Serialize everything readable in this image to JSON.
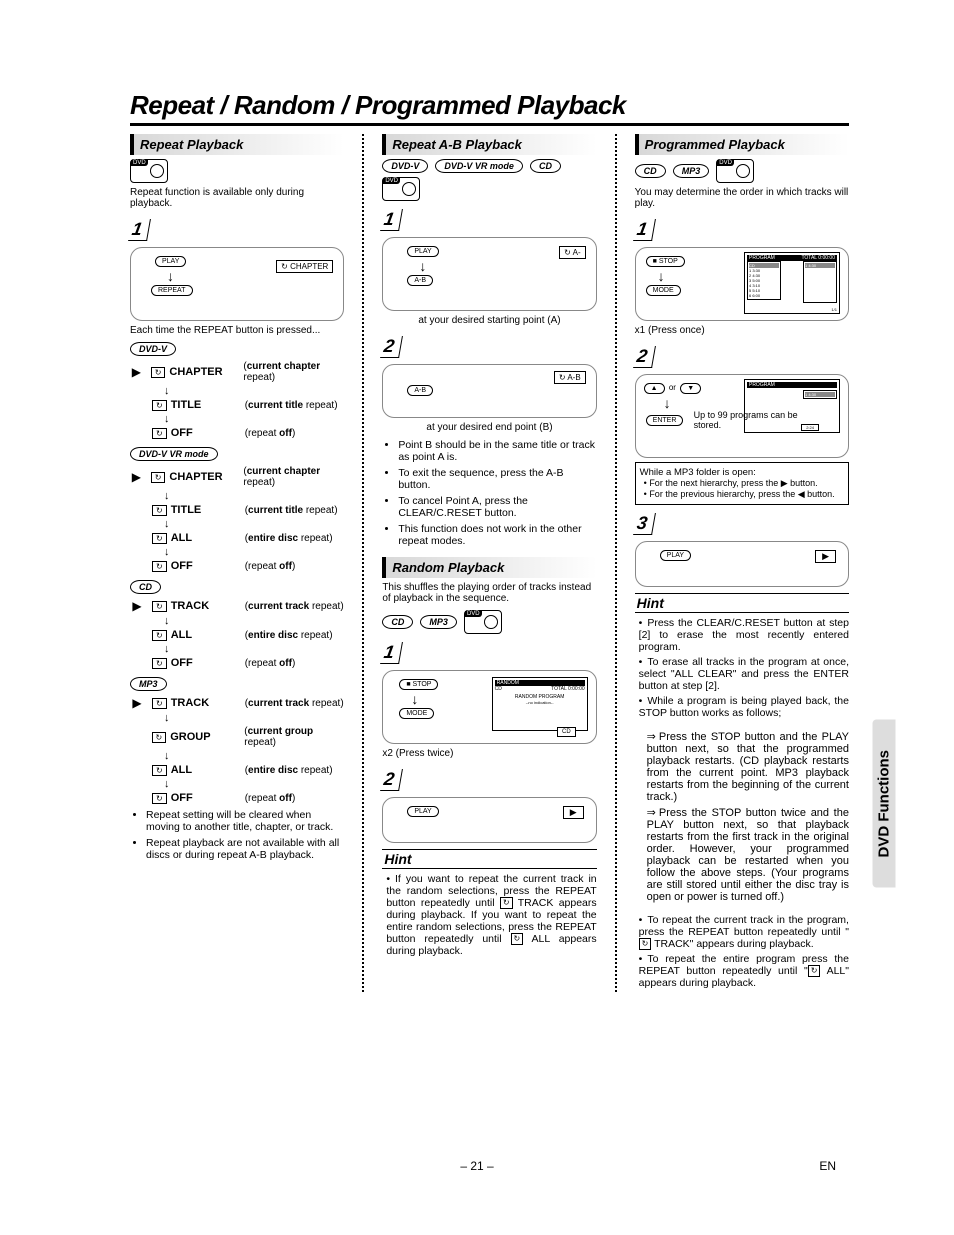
{
  "page": {
    "title": "Repeat / Random / Programmed Playback",
    "number": "– 21 –",
    "lang": "EN",
    "side_tab": "DVD Functions"
  },
  "col1": {
    "head": "Repeat Playback",
    "intro": "Repeat function is available only during playback.",
    "diagram1": {
      "play": "PLAY",
      "osd": "CHAPTER",
      "repeat": "REPEAT"
    },
    "diagram1_caption": "Each time the REPEAT button is pressed...",
    "badges": {
      "dvdv": "DVD-V",
      "dvdv_vr": "DVD-V VR mode",
      "cd": "CD",
      "mp3": "MP3"
    },
    "flow_dvdv": [
      {
        "label": "CHAPTER",
        "desc_b": "current chapter",
        "desc_end": " repeat)"
      },
      {
        "label": "TITLE",
        "desc_b": "current title",
        "desc_end": " repeat)"
      },
      {
        "label": "OFF",
        "desc_plain": "(repeat ",
        "desc_b2": "off",
        "desc_end2": ")"
      }
    ],
    "flow_dvdv_vr": [
      {
        "label": "CHAPTER",
        "desc_b": "current chapter",
        "desc_end": " repeat)"
      },
      {
        "label": "TITLE",
        "desc_b": "current title",
        "desc_end": " repeat)"
      },
      {
        "label": "ALL",
        "desc_b": "entire disc",
        "desc_end": " repeat)"
      },
      {
        "label": "OFF",
        "desc_plain": "(repeat ",
        "desc_b2": "off",
        "desc_end2": ")"
      }
    ],
    "flow_cd": [
      {
        "label": "TRACK",
        "desc_b": "current track",
        "desc_end": " repeat)"
      },
      {
        "label": "ALL",
        "desc_b": "entire disc",
        "desc_end": " repeat)"
      },
      {
        "label": "OFF",
        "desc_plain": "(repeat ",
        "desc_b2": "off",
        "desc_end2": ")"
      }
    ],
    "flow_mp3": [
      {
        "label": "TRACK",
        "desc_b": "current track",
        "desc_end": " repeat)"
      },
      {
        "label": "GROUP",
        "desc_b": "current group",
        "desc_end": " repeat)"
      },
      {
        "label": "ALL",
        "desc_b": "entire disc",
        "desc_end": " repeat)"
      },
      {
        "label": "OFF",
        "desc_plain": "(repeat ",
        "desc_b2": "off",
        "desc_end2": ")"
      }
    ],
    "notes": [
      "Repeat setting will be cleared when moving to another title, chapter, or track.",
      "Repeat playback are not available with all discs or during repeat A-B playback."
    ]
  },
  "col2": {
    "head_a": "Repeat A-B Playback",
    "badges": {
      "dvdv": "DVD-V",
      "dvdv_vr": "DVD-V VR mode",
      "cd": "CD"
    },
    "step1": {
      "num": "1",
      "play": "PLAY",
      "osd": "A-",
      "btn": "A-B",
      "caption": "at your desired starting point (A)"
    },
    "step2": {
      "num": "2",
      "osd": "A-B",
      "btn": "A-B",
      "caption": "at your desired end point (B)"
    },
    "ab_bullets": [
      "Point B should be in the same title or track as point A is.",
      "To exit the sequence, press the A-B button.",
      "To cancel Point A, press the CLEAR/C.RESET button.",
      "This function does not work in the other repeat modes."
    ],
    "head_b": "Random Playback",
    "random_intro": "This shuffles the playing order of tracks instead of playback in the sequence.",
    "rand_step1": {
      "num": "1",
      "stop": "STOP",
      "mode": "MODE",
      "caption": "x2 (Press twice)",
      "screen_title": "RANDOM",
      "screen_sub": "RANDOM PROGRAM",
      "screen_text": "--no indication--",
      "screen_top": "CD",
      "screen_right": "TOTAL  0:00:00"
    },
    "rand_step2": {
      "num": "2",
      "play": "PLAY"
    },
    "hint": "Hint",
    "hint_text": "If you want to repeat the current track in the random selections, press the REPEAT button repeatedly until  TRACK appears during playback. If you want to repeat the entire random selections, press the REPEAT button repeatedly until  ALL appears during playback."
  },
  "col3": {
    "head": "Programmed Playback",
    "badges": {
      "cd": "CD",
      "mp3": "MP3"
    },
    "intro": "You may determine the order in which tracks will play.",
    "step1": {
      "num": "1",
      "stop": "STOP",
      "mode": "MODE",
      "caption": "x1 (Press once)",
      "screen_title": "PROGRAM",
      "screen_sub": "CD",
      "screen_right": "TOTAL 0:00:00",
      "list_items": [
        "1  3:30",
        "2  4:30",
        "3  5:00",
        "4  3:10",
        "5  5:10",
        "6  6:00",
        "7",
        "8"
      ],
      "prog_item": "1  4:30",
      "footer": "1/1"
    },
    "step2": {
      "num": "2",
      "or": "or",
      "up": "▲",
      "down": "▼",
      "enter": "ENTER",
      "store_text": "Up to 99 programs can be stored.",
      "screen_title": "PROGRAM",
      "prog_item": "1  4:30",
      "footer": "2:24"
    },
    "note_box": {
      "line1": "While a MP3 folder is open:",
      "line2": "For the next hierarchy, press the ▶ button.",
      "line3": "For the previous hierarchy, press the ◀ button."
    },
    "step3": {
      "num": "3",
      "play": "PLAY"
    },
    "hint": "Hint",
    "hints": [
      "Press the CLEAR/C.RESET button at step [2] to erase the most recently entered program.",
      "To erase all tracks in the program at once, select \"ALL CLEAR\" and press the ENTER button at step [2].",
      "While a program is being played back, the STOP button works as follows;"
    ],
    "hints_arrow": [
      "Press the STOP button and the PLAY button next, so that the programmed playback restarts. (CD playback restarts from the current point. MP3 playback restarts from the beginning of the current track.)",
      "Press the STOP button twice and the PLAY button next, so that playback restarts from the first track in the original order. However, your programmed playback can be restarted when you follow the above steps. (Your programs are still stored until either the disc tray is open or power is turned off.)"
    ],
    "hints2": [
      "To repeat the current track in the program, press the REPEAT button repeatedly until \" TRACK\" appears during playback.",
      "To repeat the entire program press the REPEAT button repeatedly until \" ALL\" appears during playback."
    ]
  }
}
